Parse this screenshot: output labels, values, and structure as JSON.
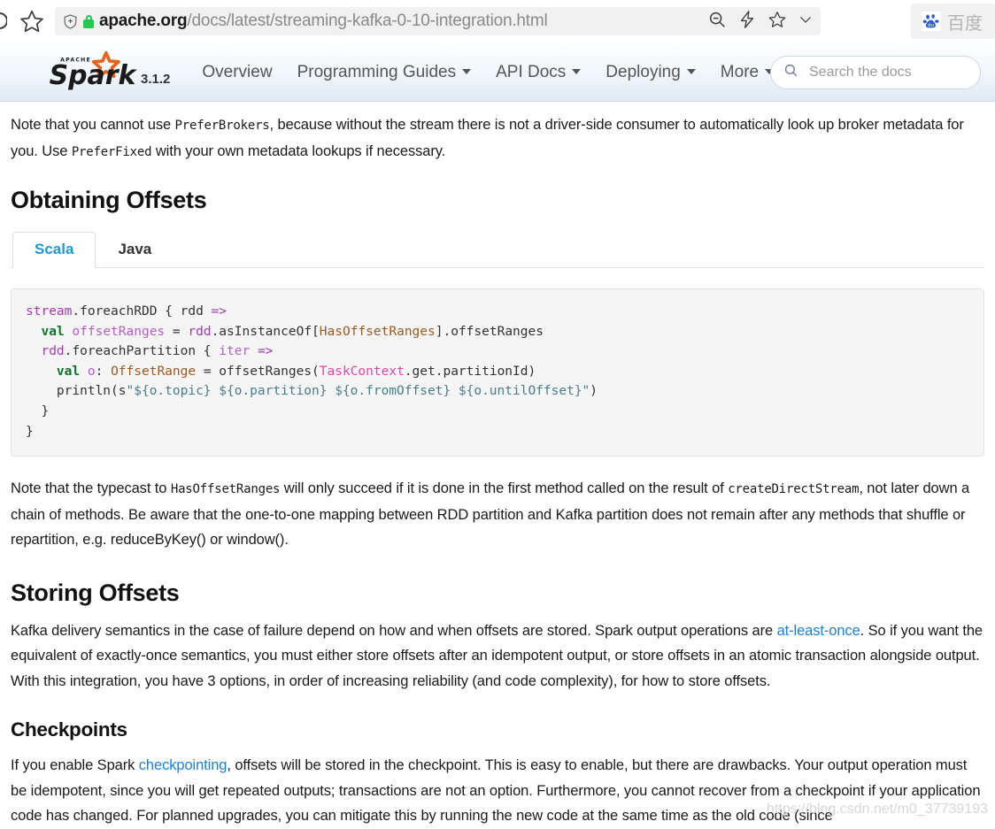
{
  "browser": {
    "url_host": "apache.org",
    "url_path": "/docs/latest/streaming-kafka-0-10-integration.html",
    "icons": {
      "reload": "reload-icon",
      "star_left": "star-icon",
      "shield": "tracking-protection-shield-icon",
      "lock": "secure-lock-icon",
      "zoom_out": "zoom-out-icon",
      "bolt": "reader-bolt-icon",
      "star_right": "bookmark-star-icon",
      "chevron": "chevron-down-icon"
    },
    "bookmark": {
      "label": "百度",
      "logo": "baidu-paw-icon"
    }
  },
  "navbar": {
    "brand_alt": "Apache Spark",
    "brand_word": "Spark",
    "brand_super": "APACHE",
    "version": "3.1.2",
    "items": [
      {
        "label": "Overview",
        "has_caret": false
      },
      {
        "label": "Programming Guides",
        "has_caret": true
      },
      {
        "label": "API Docs",
        "has_caret": true
      },
      {
        "label": "Deploying",
        "has_caret": true
      },
      {
        "label": "More",
        "has_caret": true
      }
    ],
    "search": {
      "placeholder": "Search the docs",
      "icon": "search-icon",
      "value": ""
    }
  },
  "content": {
    "intro_paragraph": {
      "p1": "Note that you cannot use ",
      "code1": "PreferBrokers",
      "p2": ", because without the stream there is not a driver-side consumer to automatically look up broker metadata for you. Use ",
      "code2": "PreferFixed",
      "p3": " with your own metadata lookups if necessary."
    },
    "obtaining_offsets": {
      "heading": "Obtaining Offsets",
      "tabs": [
        {
          "label": "Scala",
          "active": true
        },
        {
          "label": "Java",
          "active": false
        }
      ],
      "code_lines": [
        [
          {
            "t": "stream",
            "c": "tok-obj"
          },
          {
            "t": ".foreachRDD { rdd ",
            "c": "tok-plain"
          },
          {
            "t": "=>",
            "c": "tok-obj"
          }
        ],
        [
          {
            "t": "  ",
            "c": "tok-plain"
          },
          {
            "t": "val",
            "c": "tok-kw"
          },
          {
            "t": " ",
            "c": "tok-plain"
          },
          {
            "t": "offsetRanges",
            "c": "tok-var"
          },
          {
            "t": " = ",
            "c": "tok-plain"
          },
          {
            "t": "rdd",
            "c": "tok-obj"
          },
          {
            "t": ".asInstanceOf[",
            "c": "tok-plain"
          },
          {
            "t": "HasOffsetRanges",
            "c": "tok-type"
          },
          {
            "t": "].offsetRanges",
            "c": "tok-plain"
          }
        ],
        [
          {
            "t": "  ",
            "c": "tok-plain"
          },
          {
            "t": "rdd",
            "c": "tok-obj"
          },
          {
            "t": ".foreachPartition { ",
            "c": "tok-plain"
          },
          {
            "t": "iter",
            "c": "tok-var"
          },
          {
            "t": " ",
            "c": "tok-plain"
          },
          {
            "t": "=>",
            "c": "tok-obj"
          }
        ],
        [
          {
            "t": "    ",
            "c": "tok-plain"
          },
          {
            "t": "val",
            "c": "tok-kw"
          },
          {
            "t": " ",
            "c": "tok-plain"
          },
          {
            "t": "o",
            "c": "tok-var"
          },
          {
            "t": ": ",
            "c": "tok-plain"
          },
          {
            "t": "OffsetRange",
            "c": "tok-type"
          },
          {
            "t": " = offsetRanges(",
            "c": "tok-plain"
          },
          {
            "t": "TaskContext",
            "c": "tok-cls"
          },
          {
            "t": ".get.partitionId)",
            "c": "tok-plain"
          }
        ],
        [
          {
            "t": "    println(s",
            "c": "tok-plain"
          },
          {
            "t": "\"${o.topic} ${o.partition} ${o.fromOffset} ${o.untilOffset}\"",
            "c": "tok-str"
          },
          {
            "t": ")",
            "c": "tok-plain"
          }
        ],
        [
          {
            "t": "  }",
            "c": "tok-plain"
          }
        ],
        [
          {
            "t": "}",
            "c": "tok-plain"
          }
        ]
      ],
      "after_code": {
        "p1": "Note that the typecast to ",
        "code1": "HasOffsetRanges",
        "p2": " will only succeed if it is done in the first method called on the result of ",
        "code2": "createDirectStream",
        "p3": ", not later down a chain of methods. Be aware that the one-to-one mapping between RDD partition and Kafka partition does not remain after any methods that shuffle or repartition, e.g. reduceByKey() or window()."
      }
    },
    "storing_offsets": {
      "heading": "Storing Offsets",
      "p1": "Kafka delivery semantics in the case of failure depend on how and when offsets are stored. Spark output operations are ",
      "link": "at-least-once",
      "p2": ". So if you want the equivalent of exactly-once semantics, you must either store offsets after an idempotent output, or store offsets in an atomic transaction alongside output. With this integration, you have 3 options, in order of increasing reliability (and code complexity), for how to store offsets."
    },
    "checkpoints": {
      "heading": "Checkpoints",
      "p1": "If you enable Spark ",
      "link": "checkpointing",
      "p2": ", offsets will be stored in the checkpoint. This is easy to enable, but there are drawbacks. Your output operation must be idempotent, since you will get repeated outputs; transactions are not an option. Furthermore, you cannot recover from a checkpoint if your application code has changed. For planned upgrades, you can mitigate this by running the new code at the same time as the old code (since"
    }
  },
  "watermark": {
    "text": "https://blog.csdn.net/m0_37739193"
  }
}
